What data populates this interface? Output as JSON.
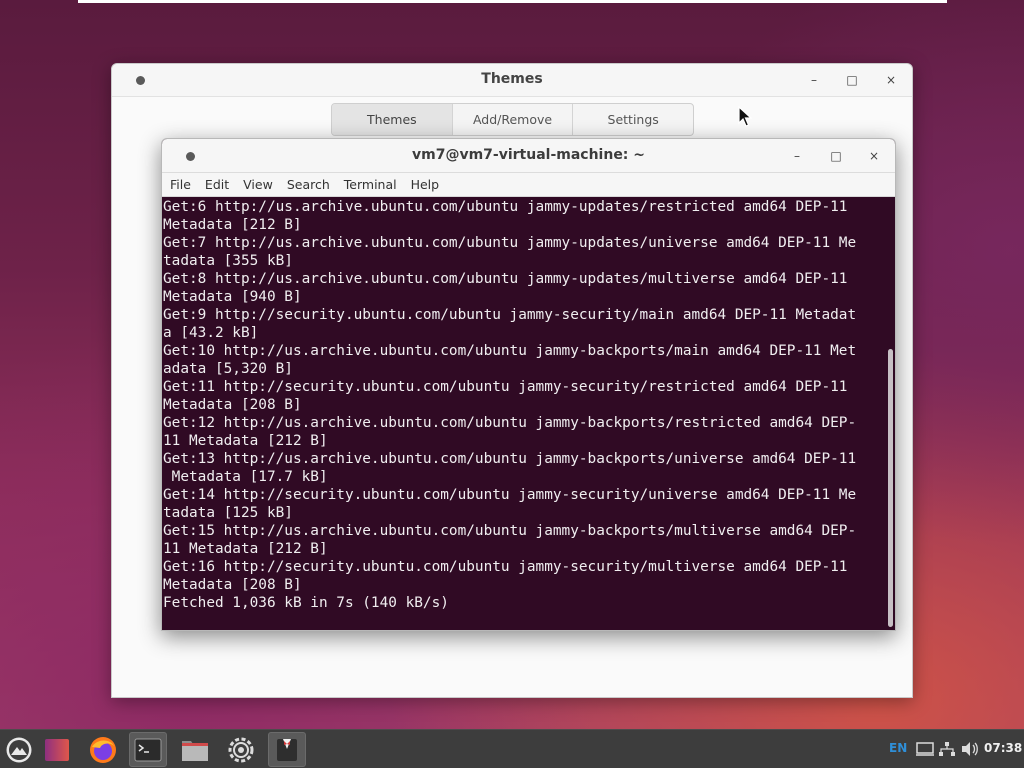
{
  "themes_window": {
    "title": "Themes",
    "tabs": [
      "Themes",
      "Add/Remove",
      "Settings"
    ],
    "active_tab": "Themes",
    "minimize_glyph": "–",
    "maximize_glyph": "□",
    "close_glyph": "×"
  },
  "terminal_window": {
    "title": "vm7@vm7-virtual-machine: ~",
    "menu": [
      "File",
      "Edit",
      "View",
      "Search",
      "Terminal",
      "Help"
    ],
    "lines": [
      "Get:6 http://us.archive.ubuntu.com/ubuntu jammy-updates/restricted amd64 DEP-11",
      "Metadata [212 B]",
      "Get:7 http://us.archive.ubuntu.com/ubuntu jammy-updates/universe amd64 DEP-11 Me",
      "tadata [355 kB]",
      "Get:8 http://us.archive.ubuntu.com/ubuntu jammy-updates/multiverse amd64 DEP-11",
      "Metadata [940 B]",
      "Get:9 http://security.ubuntu.com/ubuntu jammy-security/main amd64 DEP-11 Metadat",
      "a [43.2 kB]",
      "Get:10 http://us.archive.ubuntu.com/ubuntu jammy-backports/main amd64 DEP-11 Met",
      "adata [5,320 B]",
      "Get:11 http://security.ubuntu.com/ubuntu jammy-security/restricted amd64 DEP-11",
      "Metadata [208 B]",
      "Get:12 http://us.archive.ubuntu.com/ubuntu jammy-backports/restricted amd64 DEP-",
      "11 Metadata [212 B]",
      "Get:13 http://us.archive.ubuntu.com/ubuntu jammy-backports/universe amd64 DEP-11",
      " Metadata [17.7 kB]",
      "Get:14 http://security.ubuntu.com/ubuntu jammy-security/universe amd64 DEP-11 Me",
      "tadata [125 kB]",
      "Get:15 http://us.archive.ubuntu.com/ubuntu jammy-backports/multiverse amd64 DEP-",
      "11 Metadata [212 B]",
      "Get:16 http://security.ubuntu.com/ubuntu jammy-security/multiverse amd64 DEP-11",
      "Metadata [208 B]",
      "Fetched 1,036 kB in 7s (140 kB/s)"
    ],
    "background_color": "#300a24",
    "text_color": "#f0eef0"
  },
  "taskbar": {
    "apps": [
      {
        "name": "app-menu",
        "icon": "ubuntu-mountain-icon"
      },
      {
        "name": "desktop",
        "icon": "show-desktop-icon"
      },
      {
        "name": "firefox",
        "icon": "firefox-icon"
      },
      {
        "name": "terminal",
        "icon": "terminal-icon"
      },
      {
        "name": "files",
        "icon": "folder-icon"
      },
      {
        "name": "settings",
        "icon": "gear-icon"
      },
      {
        "name": "themes",
        "icon": "tuxedo-icon"
      }
    ],
    "keyboard_layout": "EN",
    "clock": "07:38",
    "accent_color": "#2f8fd8"
  }
}
